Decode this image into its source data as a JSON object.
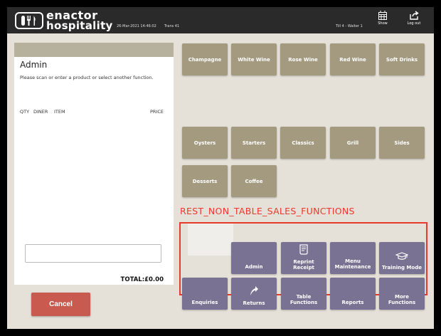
{
  "header": {
    "brand_line1": "enactor",
    "brand_line2": "hospitality",
    "datetime": "26-Mar-2021 14:46:02",
    "trans": "Trans 41",
    "till": "Till 4 - Waiter 1",
    "show_label": "Show",
    "logout_label": "Log out"
  },
  "order_panel": {
    "title": "Admin",
    "message": "Please scan or enter a product or select another function.",
    "columns": [
      "QTY",
      "DINER",
      "ITEM",
      "PRICE"
    ],
    "input_value": "",
    "total": "TOTAL:£0.00",
    "cancel_label": "Cancel"
  },
  "drinks": [
    "Champagne",
    "White Wine",
    "Rose Wine",
    "Red Wine",
    "Soft Drinks"
  ],
  "food_row1": [
    "Oysters",
    "Starters",
    "Classics",
    "Grill",
    "Sides"
  ],
  "food_row2": [
    "Desserts",
    "Coffee"
  ],
  "functions_label": "REST_NON_TABLE_SALES_FUNCTIONS",
  "functions": {
    "row1": [
      "Admin",
      "Reprint Receipt",
      "Menu Maintenance",
      "Training Mode"
    ],
    "row2": [
      "Enquiries",
      "Returns",
      "Table Functions",
      "Reports",
      "More Functions"
    ]
  },
  "colors": {
    "tan_button": "#a39a80",
    "purple_button": "#7a7292",
    "cancel_button": "#c85a50",
    "highlight": "#e83a2a",
    "background": "#e5e1d8"
  },
  "icons": {
    "show": "grid-icon",
    "logout": "logout-icon",
    "reprint": "receipt-icon",
    "training": "graduation-cap-icon",
    "returns": "return-arrow-icon"
  }
}
